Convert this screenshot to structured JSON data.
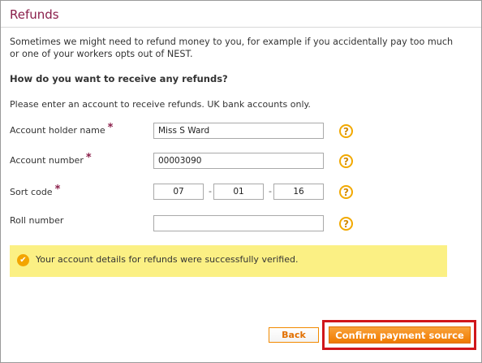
{
  "page": {
    "title": "Refunds",
    "intro": "Sometimes we might need to refund money to you, for example if you accidentally pay too much or one of your workers opts out of NEST.",
    "question": "How do you want to receive any refunds?",
    "instruction": "Please enter an account to receive refunds. UK bank accounts only."
  },
  "form": {
    "required_marker": "*",
    "help_glyph": "?",
    "sort_separator": "-",
    "account_holder": {
      "label": "Account holder name",
      "value": "Miss S Ward"
    },
    "account_number": {
      "label": "Account number",
      "value": "00003090"
    },
    "sort_code": {
      "label": "Sort code",
      "parts": [
        "07",
        "01",
        "16"
      ]
    },
    "roll_number": {
      "label": "Roll number",
      "value": ""
    }
  },
  "alert": {
    "message": "Your account details for refunds were successfully verified.",
    "icon": "check-circle-icon",
    "icon_glyph": "✔"
  },
  "buttons": {
    "back_label": "Back",
    "confirm_label": "Confirm payment source"
  },
  "colors": {
    "title": "#8a1e4a",
    "accent": "#ef7a00",
    "alert_bg": "#fbf084",
    "highlight": "#d0161b"
  }
}
